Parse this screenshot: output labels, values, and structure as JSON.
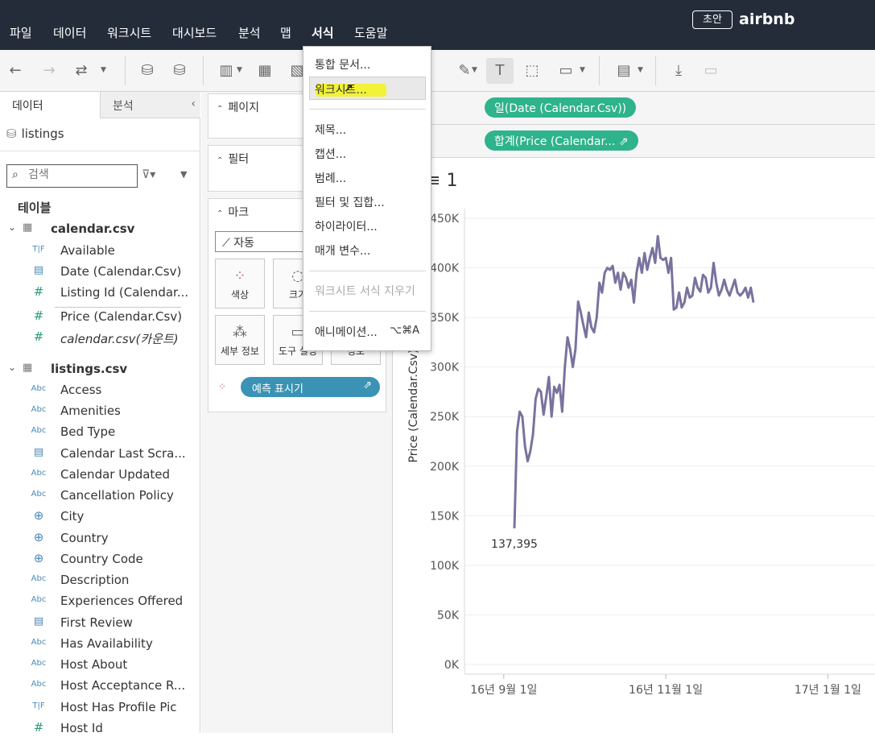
{
  "menubar": {
    "items": [
      "파일",
      "데이터",
      "워크시트",
      "대시보드",
      "분석",
      "맵",
      "서식",
      "도움말"
    ],
    "draft_badge": "초안",
    "workbook_title": "airbnb"
  },
  "data_pane": {
    "tab_data": "데이터",
    "tab_analysis": "분석",
    "datasource": "listings",
    "search_placeholder": "검색",
    "section_title": "테이블",
    "tables": [
      {
        "name": "calendar.csv",
        "fields": [
          {
            "type": "T|F",
            "label": "Available"
          },
          {
            "type": "date",
            "label": "Date (Calendar.Csv)"
          },
          {
            "type": "#",
            "label": "Listing Id (Calendar..."
          },
          {
            "type": "#",
            "label": "Price (Calendar.Csv)"
          },
          {
            "type": "#",
            "label": "calendar.csv(카운트)"
          }
        ]
      },
      {
        "name": "listings.csv",
        "fields": [
          {
            "type": "Abc",
            "label": "Access"
          },
          {
            "type": "Abc",
            "label": "Amenities"
          },
          {
            "type": "Abc",
            "label": "Bed Type"
          },
          {
            "type": "date",
            "label": "Calendar Last Scra..."
          },
          {
            "type": "Abc",
            "label": "Calendar Updated"
          },
          {
            "type": "Abc",
            "label": "Cancellation Policy"
          },
          {
            "type": "geo",
            "label": "City"
          },
          {
            "type": "geo",
            "label": "Country"
          },
          {
            "type": "geo",
            "label": "Country Code"
          },
          {
            "type": "Abc",
            "label": "Description"
          },
          {
            "type": "Abc",
            "label": "Experiences Offered"
          },
          {
            "type": "date",
            "label": "First Review"
          },
          {
            "type": "Abc",
            "label": "Has Availability"
          },
          {
            "type": "Abc",
            "label": "Host About"
          },
          {
            "type": "Abc",
            "label": "Host Acceptance R..."
          },
          {
            "type": "T|F",
            "label": "Host Has Profile Pic"
          },
          {
            "type": "#",
            "label": "Host Id"
          }
        ]
      }
    ]
  },
  "shelves": {
    "pages": "페이지",
    "filters": "필터",
    "marks": "마크",
    "mark_type": "자동",
    "mark_buttons": [
      "색상",
      "크기",
      "세부 정보",
      "도구 설명",
      "정보"
    ],
    "forecast_pill": "예측 표시기"
  },
  "view": {
    "columns_pill": "일(Date (Calendar.Csv))",
    "rows_pill": "합계(Price (Calendar...",
    "sheet_title_fragment": "1"
  },
  "dropdown": {
    "items": [
      {
        "label": "통합 문서...",
        "disabled": false
      },
      {
        "label": "워크시트...",
        "disabled": false,
        "highlighted": true
      },
      {
        "label": "제목...",
        "disabled": false
      },
      {
        "label": "캡션...",
        "disabled": false
      },
      {
        "label": "범례...",
        "disabled": false
      },
      {
        "label": "필터 및 집합...",
        "disabled": false
      },
      {
        "label": "하이라이터...",
        "disabled": false
      },
      {
        "label": "매개 변수...",
        "disabled": false
      },
      {
        "label": "워크시트 서식 지우기",
        "disabled": true
      },
      {
        "label": "애니메이션...",
        "disabled": false,
        "shortcut": "⌥⌘A"
      }
    ]
  },
  "chart_data": {
    "type": "line",
    "ylabel": "Price (Calendar.Csv)",
    "yticks": [
      "0K",
      "50K",
      "100K",
      "150K",
      "200K",
      "250K",
      "300K",
      "350K",
      "400K",
      "450K"
    ],
    "ylim": [
      0,
      450000
    ],
    "xticks": [
      "16년 9월 1일",
      "16년 11월 1일",
      "17년 1월 1일"
    ],
    "x_start": "2016-09-05",
    "annotation": {
      "label": "137,395",
      "value": 137395
    },
    "line_color": "#7a729e",
    "values": [
      137395,
      235000,
      255000,
      250000,
      220000,
      205000,
      215000,
      232000,
      268000,
      278000,
      275000,
      252000,
      270000,
      290000,
      250000,
      280000,
      274000,
      282000,
      255000,
      300000,
      330000,
      318000,
      300000,
      318000,
      366000,
      355000,
      342000,
      330000,
      355000,
      340000,
      335000,
      350000,
      385000,
      375000,
      395000,
      400000,
      398000,
      402000,
      385000,
      395000,
      378000,
      395000,
      390000,
      380000,
      388000,
      365000,
      395000,
      410000,
      395000,
      415000,
      398000,
      410000,
      420000,
      405000,
      432000,
      410000,
      408000,
      410000,
      395000,
      410000,
      358000,
      360000,
      375000,
      360000,
      365000,
      380000,
      370000,
      372000,
      390000,
      380000,
      376000,
      393000,
      390000,
      375000,
      380000,
      405000,
      385000,
      372000,
      378000,
      388000,
      378000,
      372000,
      380000,
      388000,
      375000,
      372000,
      375000,
      380000,
      370000,
      380000,
      365000
    ]
  }
}
